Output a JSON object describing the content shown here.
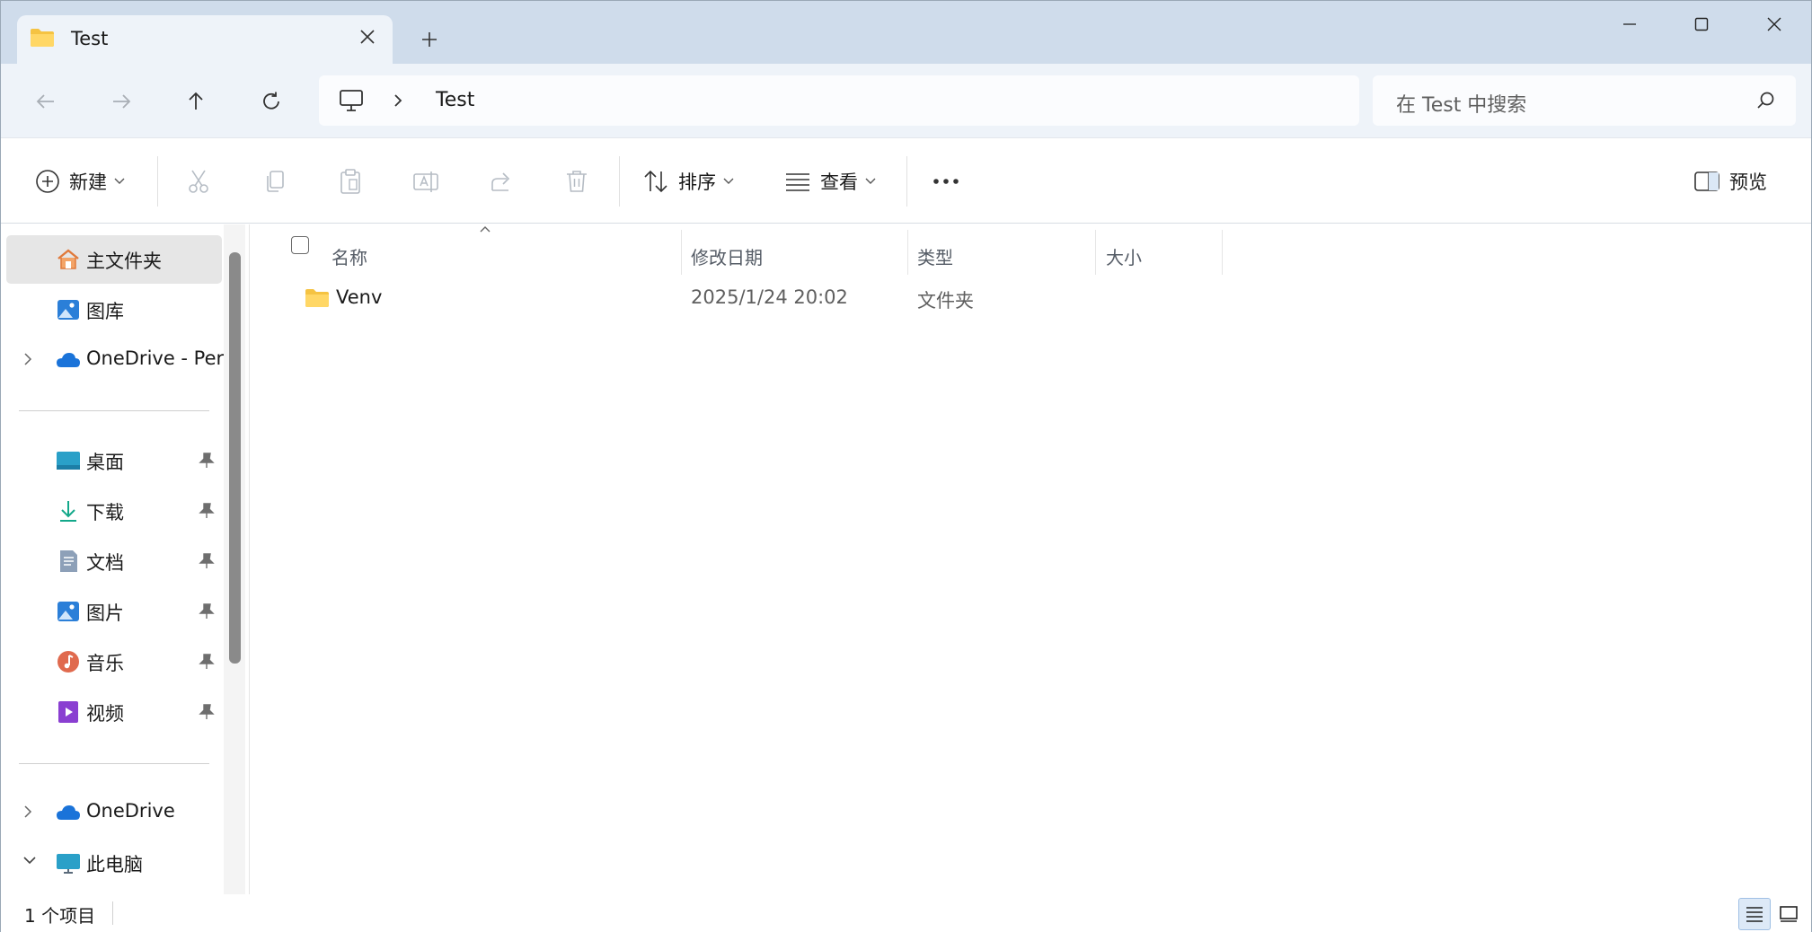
{
  "tab": {
    "title": "Test",
    "close_icon": "close-icon",
    "new_tab_icon": "plus-icon"
  },
  "window_controls": [
    "minimize-icon",
    "maximize-icon",
    "close-icon"
  ],
  "nav": {
    "back_icon": "arrow-left-icon",
    "forward_icon": "arrow-right-icon",
    "up_icon": "arrow-up-icon",
    "refresh_icon": "refresh-icon",
    "breadcrumb": [
      "Test"
    ],
    "search_placeholder": "在 Test 中搜索"
  },
  "toolbar": {
    "new_label": "新建",
    "sort_label": "排序",
    "view_label": "查看",
    "preview_label": "预览",
    "more_icon": "more-icon"
  },
  "sidebar": {
    "items": [
      {
        "label": "主文件夹",
        "icon": "home-icon",
        "selected": true
      },
      {
        "label": "图库",
        "icon": "gallery-icon"
      },
      {
        "label": "OneDrive - Per",
        "icon": "onedrive-icon",
        "expandable": true
      },
      {
        "label": "桌面",
        "icon": "desktop-icon",
        "pinned": true
      },
      {
        "label": "下载",
        "icon": "download-icon",
        "pinned": true
      },
      {
        "label": "文档",
        "icon": "documents-icon",
        "pinned": true
      },
      {
        "label": "图片",
        "icon": "pictures-icon",
        "pinned": true
      },
      {
        "label": "音乐",
        "icon": "music-icon",
        "pinned": true
      },
      {
        "label": "视频",
        "icon": "videos-icon",
        "pinned": true
      },
      {
        "label": "OneDrive",
        "icon": "onedrive-icon",
        "expandable": true
      },
      {
        "label": "此电脑",
        "icon": "this-pc-icon",
        "expanded": true
      }
    ]
  },
  "columns": {
    "name": "名称",
    "modified": "修改日期",
    "type": "类型",
    "size": "大小"
  },
  "rows": [
    {
      "name": "Venv",
      "modified": "2025/1/24 20:02",
      "type": "文件夹",
      "size": ""
    }
  ],
  "status": {
    "count": "1 个项目"
  },
  "colors": {
    "titlebar": "#cfdceb",
    "navbar": "#eef3f9",
    "selection": "#e6e6e6",
    "folder": "#f5c342",
    "accent": "#0067c0"
  }
}
